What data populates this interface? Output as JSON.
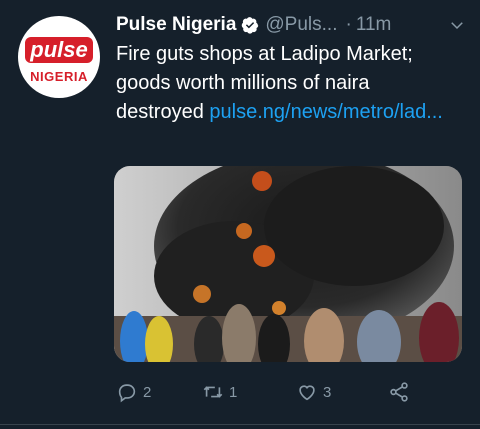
{
  "tweet": {
    "avatar": {
      "logo_text": "pulse",
      "logo_sub": "NIGERIA"
    },
    "author_name": "Pulse Nigeria",
    "handle": "@Puls...",
    "separator": "·",
    "time": "11m",
    "text": "Fire guts shops at Ladipo Market; goods worth millions of naira destroyed",
    "link": "pulse.ng/news/metro/lad..."
  },
  "actions": {
    "reply_count": "2",
    "retweet_count": "1",
    "like_count": "3"
  },
  "icons": {
    "verified": "verified-badge-icon",
    "menu": "chevron-down-icon",
    "reply": "reply-icon",
    "retweet": "retweet-icon",
    "like": "heart-icon",
    "share": "share-icon"
  },
  "colors": {
    "background": "#15202b",
    "text": "#ffffff",
    "muted": "#8899a6",
    "link": "#1da1f2",
    "brand_red": "#d61f2a"
  }
}
